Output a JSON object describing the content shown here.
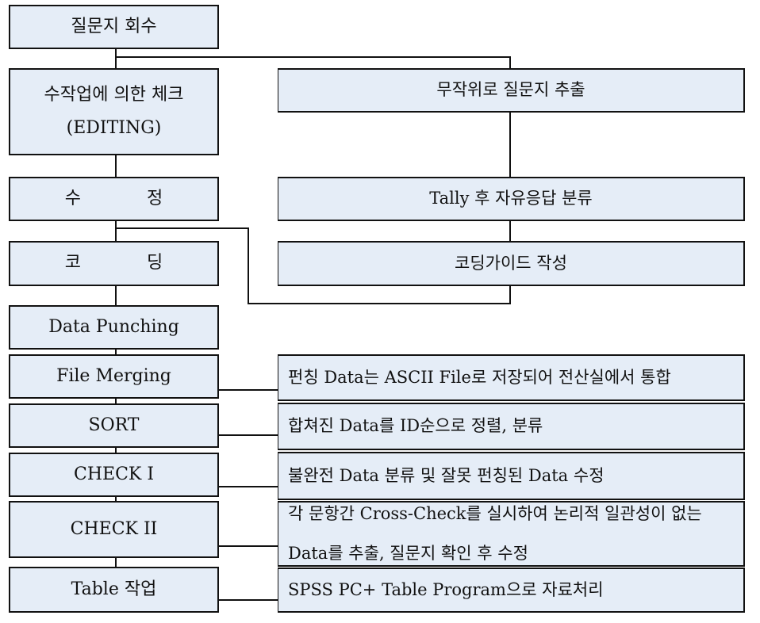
{
  "diagram": {
    "title": "",
    "main_flow": [
      {
        "id": "collect",
        "label": "질문지 회수"
      },
      {
        "id": "editing",
        "label_line1": "수작업에 의한 체크",
        "label_line2": "(EDITING)"
      },
      {
        "id": "correction",
        "label": "수 정"
      },
      {
        "id": "coding",
        "label": "코 딩"
      },
      {
        "id": "punching",
        "label": "Data Punching"
      },
      {
        "id": "merging",
        "label": "File Merging"
      },
      {
        "id": "sort",
        "label": "SORT"
      },
      {
        "id": "check1",
        "label": "CHECK I"
      },
      {
        "id": "check2",
        "label": "CHECK II"
      },
      {
        "id": "table",
        "label": "Table 작업"
      }
    ],
    "side_flow": [
      {
        "id": "random-extract",
        "label": "무작위로 질문지 추출"
      },
      {
        "id": "tally",
        "label": "Tally 후 자유응답 분류"
      },
      {
        "id": "coding-guide",
        "label": "코딩가이드 작성"
      }
    ],
    "descriptions": [
      {
        "for": "merging",
        "text": "펀칭 Data는 ASCII File로 저장되어 전산실에서 통합"
      },
      {
        "for": "sort",
        "text": "합쳐진 Data를 ID순으로 정렬, 분류"
      },
      {
        "for": "check1",
        "text": "불완전 Data 분류 및 잘못 펀칭된 Data 수정"
      },
      {
        "for": "check2",
        "text_line1": "각 문항간 Cross-Check를 실시하여 논리적 일관성이 없는",
        "text_line2": "Data를 추출, 질문지 확인 후 수정"
      },
      {
        "for": "table",
        "text": "SPSS PC+ Table Program으로 자료처리"
      }
    ],
    "colors": {
      "box_fill": "#e5edf7",
      "border": "#111111"
    }
  }
}
